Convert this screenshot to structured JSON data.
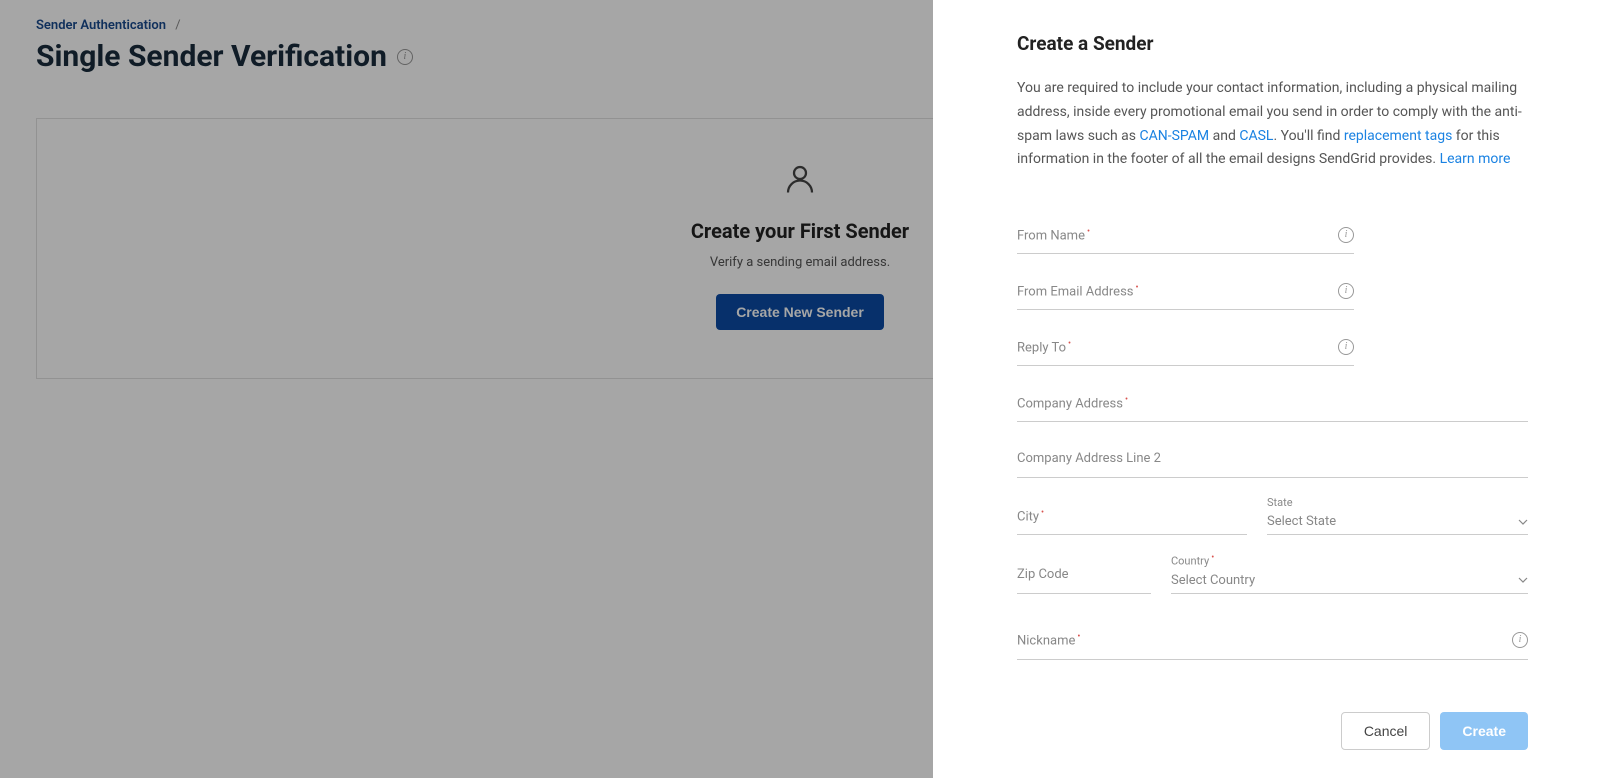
{
  "breadcrumb": {
    "parent": "Sender Authentication",
    "separator": "/"
  },
  "page": {
    "title": "Single Sender Verification"
  },
  "onboard": {
    "title": "Create your First Sender",
    "subtitle": "Verify a sending email address.",
    "cta": "Create New Sender"
  },
  "panel": {
    "title": "Create a Sender",
    "desc_part1": "You are required to include your contact information, including a physical mailing address, inside every promotional email you send in order to comply with the anti-spam laws such as ",
    "link_canspam": "CAN-SPAM",
    "desc_and": " and ",
    "link_casl": "CASL",
    "desc_part2": ". You'll find ",
    "link_replacement": "replacement tags",
    "desc_part3": " for this information in the footer of all the email designs SendGrid provides. ",
    "link_learn": "Learn more",
    "fields": {
      "from_name": "From Name",
      "from_email": "From Email Address",
      "reply_to": "Reply To",
      "company_addr": "Company Address",
      "company_addr2": "Company Address Line 2",
      "city": "City",
      "state_label": "State",
      "state_placeholder": "Select State",
      "zip": "Zip Code",
      "country_label": "Country",
      "country_placeholder": "Select Country",
      "nickname": "Nickname"
    },
    "buttons": {
      "cancel": "Cancel",
      "create": "Create"
    }
  }
}
